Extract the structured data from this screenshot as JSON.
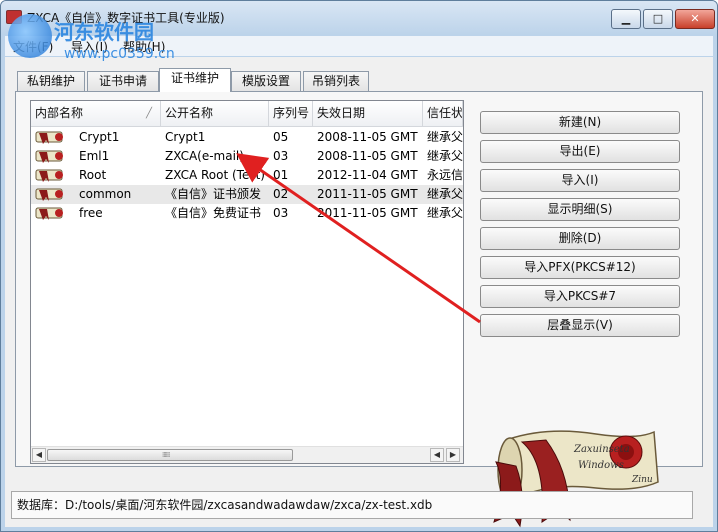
{
  "window": {
    "title": "ZXCA《自信》数字证书工具(专业版)",
    "min_label": "▁",
    "max_label": "□",
    "close_label": "✕"
  },
  "menu": [
    "文件(F)",
    "导入(I)",
    "帮助(H)"
  ],
  "tabs": [
    "私钥维护",
    "证书申请",
    "证书维护",
    "模版设置",
    "吊销列表"
  ],
  "active_tab": "证书维护",
  "columns": [
    "内部名称",
    "公开名称",
    "序列号",
    "失效日期",
    "信任状"
  ],
  "rows": [
    {
      "internal": "Crypt1",
      "public": "Crypt1",
      "serial": "05",
      "expiry": "2008-11-05 GMT",
      "trust": "继承父"
    },
    {
      "internal": "Eml1",
      "public": "ZXCA(e-mail)",
      "serial": "03",
      "expiry": "2008-11-05 GMT",
      "trust": "继承父"
    },
    {
      "internal": "Root",
      "public": "ZXCA Root (Test)",
      "serial": "01",
      "expiry": "2012-11-04 GMT",
      "trust": "永远信"
    },
    {
      "internal": "common",
      "public": "《自信》证书颁发",
      "serial": "02",
      "expiry": "2011-11-05 GMT",
      "trust": "继承父"
    },
    {
      "internal": "free",
      "public": "《自信》免费证书",
      "serial": "03",
      "expiry": "2011-11-05 GMT",
      "trust": "继承父"
    }
  ],
  "selected_row": 3,
  "buttons": [
    "新建(N)",
    "导出(E)",
    "导入(I)",
    "显示明细(S)",
    "删除(D)",
    "导入PFX(PKCS#12)",
    "导入PKCS#7",
    "层叠显示(V)"
  ],
  "status_bar": "数据库：D:/tools/桌面/河东软件园/zxcasandwadawdaw/zxca/zx-test.xdb",
  "scroll_art": {
    "line1": "Zaxuinseta",
    "line2": "Windows",
    "line3": "Zinu"
  },
  "watermark": {
    "name": "河东软件园",
    "url": "www.pc0359.cn"
  },
  "sort_indicator": "╱",
  "scroll_left": "◀",
  "scroll_right": "▶",
  "scroll_grip": "⁞⁞⁞⁞⁞⁞",
  "colors": {
    "arrow": "#e02020",
    "window_frame": "#bcd3ea",
    "watermark": "#2b86e0"
  }
}
